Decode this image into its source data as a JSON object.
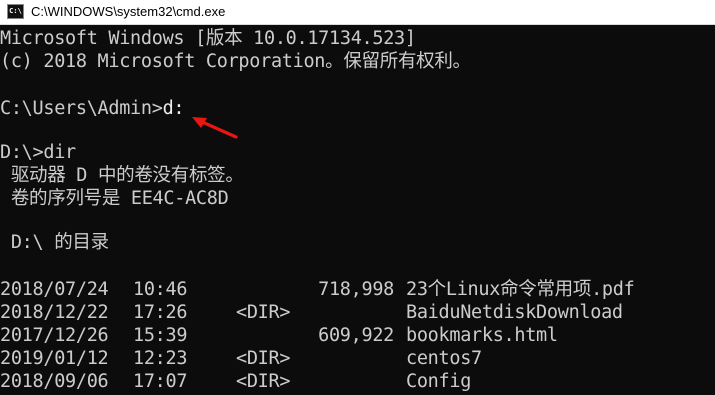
{
  "window": {
    "title": "C:\\WINDOWS\\system32\\cmd.exe",
    "icon_label": "C:\\",
    "icon": "cmd-icon"
  },
  "console": {
    "lines": [
      "Microsoft Windows [版本 10.0.17134.523]",
      "(c) 2018 Microsoft Corporation。保留所有权利。",
      "",
      "C:\\Users\\Admin>",
      "",
      "D:\\>dir",
      " 驱动器 D 中的卷没有标签。",
      " 卷的序列号是 EE4C-AC8D",
      "",
      " D:\\ 的目录",
      ""
    ],
    "typed_command": "d:"
  },
  "dir_listing": [
    {
      "date": "2018/07/24",
      "time": "10:46",
      "dir": "",
      "size": "718,998",
      "name": "23个Linux命令常用项.pdf"
    },
    {
      "date": "2018/12/22",
      "time": "17:26",
      "dir": "<DIR>",
      "size": "",
      "name": "BaiduNetdiskDownload"
    },
    {
      "date": "2017/12/26",
      "time": "15:39",
      "dir": "",
      "size": "609,922",
      "name": "bookmarks.html"
    },
    {
      "date": "2019/01/12",
      "time": "12:23",
      "dir": "<DIR>",
      "size": "",
      "name": "centos7"
    },
    {
      "date": "2018/09/06",
      "time": "17:07",
      "dir": "<DIR>",
      "size": "",
      "name": "Config"
    }
  ],
  "annotation": {
    "arrow_color": "#e8170f"
  },
  "colors": {
    "console_bg": "#0c0c0c",
    "console_fg": "#cccccc",
    "titlebar_bg": "#ffffff"
  }
}
